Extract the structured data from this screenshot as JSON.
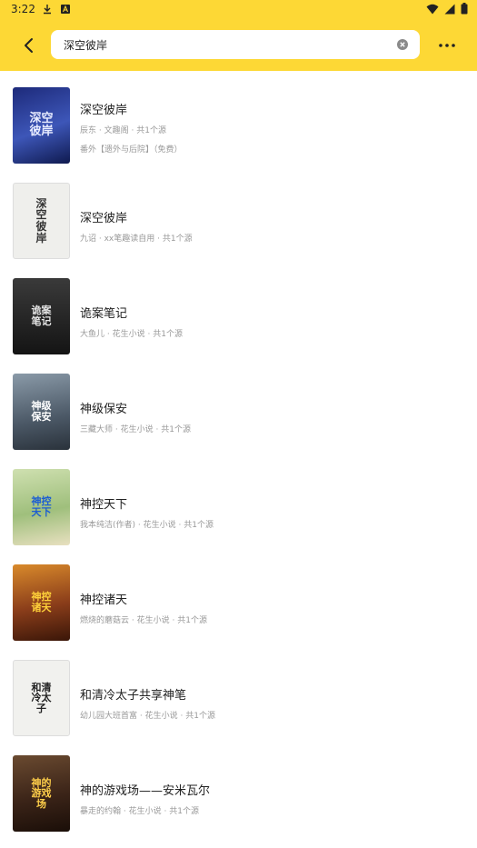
{
  "status": {
    "time": "3:22"
  },
  "search": {
    "query": "深空彼岸",
    "placeholder": ""
  },
  "results": [
    {
      "title": "深空彼岸",
      "author": "辰东",
      "source": "文趣阁",
      "count": "共1个源",
      "extra": "番外【遗外与后院】（免费）",
      "cover_text": "深空彼岸",
      "cover_bg": "#2b3a8c",
      "cover_fg": "#e8ecff"
    },
    {
      "title": "深空彼岸",
      "author": "九诏",
      "source": "xx笔趣读自用",
      "count": "共1个源",
      "extra": "",
      "cover_text": "深空彼岸",
      "cover_bg": "#efefec",
      "cover_fg": "#333333"
    },
    {
      "title": "诡案笔记",
      "author": "大鱼儿",
      "source": "花生小说",
      "count": "共1个源",
      "extra": "",
      "cover_text": "诡案笔记",
      "cover_bg": "#1c1c1c",
      "cover_fg": "#e6e6e6"
    },
    {
      "title": "神级保安",
      "author": "三藏大师",
      "source": "花生小说",
      "count": "共1个源",
      "extra": "",
      "cover_text": "神级保安",
      "cover_bg": "#5c6a78",
      "cover_fg": "#ffffff"
    },
    {
      "title": "神控天下",
      "author": "我本纯洁(作者)",
      "source": "花生小说",
      "count": "共1个源",
      "extra": "",
      "cover_text": "神控天下",
      "cover_bg": "#a9c58a",
      "cover_fg": "#1e5fd1"
    },
    {
      "title": "神控诸天",
      "author": "燃烧的蘑菇云",
      "source": "花生小说",
      "count": "共1个源",
      "extra": "",
      "cover_text": "神控诸天",
      "cover_bg": "#8a3d1a",
      "cover_fg": "#ffd23a"
    },
    {
      "title": "和清冷太子共享神笔",
      "author": "幼儿园大班首富",
      "source": "花生小说",
      "count": "共1个源",
      "extra": "",
      "cover_text": "和清冷太子",
      "cover_bg": "#f1f1ee",
      "cover_fg": "#222222"
    },
    {
      "title": "神的游戏场——安米瓦尔",
      "author": "暴走的约翰",
      "source": "花生小说",
      "count": "共1个源",
      "extra": "",
      "cover_text": "神的游戏场",
      "cover_bg": "#3b2418",
      "cover_fg": "#ffcf4a"
    }
  ],
  "colors": {
    "accent": "#fdd835"
  }
}
